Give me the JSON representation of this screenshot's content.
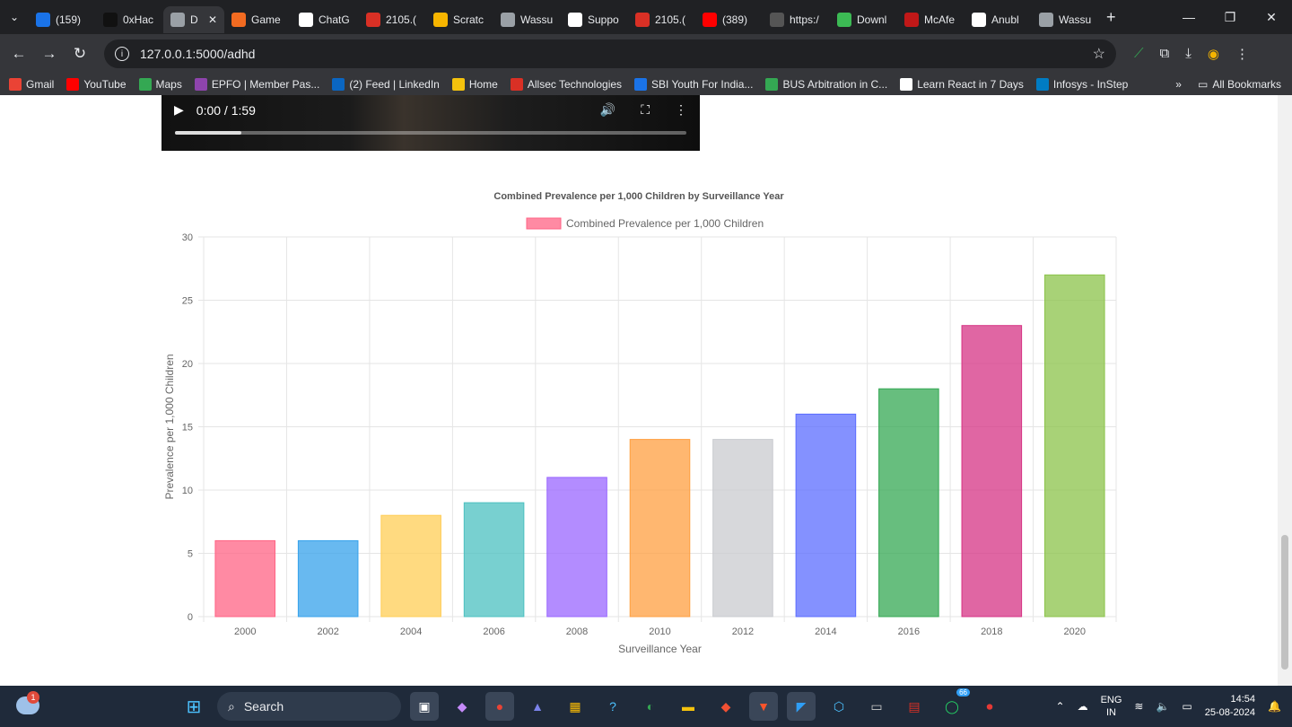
{
  "browser": {
    "tabs": [
      {
        "label": "(159)",
        "color": "#1a73e8"
      },
      {
        "label": "0xHac",
        "color": "#111111"
      },
      {
        "label": "D",
        "color": "#9aa0a6",
        "active": true
      },
      {
        "label": "Game",
        "color": "#f26b21"
      },
      {
        "label": "ChatG",
        "color": "#ffffff"
      },
      {
        "label": "2105.(",
        "color": "#d93025"
      },
      {
        "label": "Scratc",
        "color": "#f7b500"
      },
      {
        "label": "Wassu",
        "color": "#9aa0a6"
      },
      {
        "label": "Suppo",
        "color": "#ffffff"
      },
      {
        "label": "2105.(",
        "color": "#d93025"
      },
      {
        "label": "(389)",
        "color": "#ff0000"
      },
      {
        "label": "https:/",
        "color": "#555555"
      },
      {
        "label": "Downl",
        "color": "#3cba54"
      },
      {
        "label": "McAfe",
        "color": "#c01818"
      },
      {
        "label": "Anubl",
        "color": "#ffffff"
      },
      {
        "label": "Wassu",
        "color": "#9aa0a6"
      }
    ],
    "close_symbol": "✕",
    "new_tab_symbol": "+",
    "url": "127.0.0.1:5000/adhd",
    "bookmarks": [
      {
        "label": "Gmail",
        "color": "#ea4335"
      },
      {
        "label": "YouTube",
        "color": "#ff0000"
      },
      {
        "label": "Maps",
        "color": "#34a853"
      },
      {
        "label": "EPFO | Member Pas...",
        "color": "#8e44ad"
      },
      {
        "label": "(2) Feed | LinkedIn",
        "color": "#0a66c2"
      },
      {
        "label": "Home",
        "color": "#f4c20d"
      },
      {
        "label": "Allsec Technologies",
        "color": "#d93025"
      },
      {
        "label": "SBI Youth For India...",
        "color": "#1a73e8"
      },
      {
        "label": "BUS Arbitration in C...",
        "color": "#34a853"
      },
      {
        "label": "Learn React in 7 Days",
        "color": "#ffffff"
      },
      {
        "label": "Infosys - InStep",
        "color": "#007cc3"
      }
    ],
    "more_bookmarks_symbol": "»",
    "all_bookmarks": "All Bookmarks"
  },
  "video": {
    "time": "0:00 / 1:59",
    "progress": 0.13
  },
  "chart_data": {
    "type": "bar",
    "title": "Combined Prevalence per 1,000 Children by Surveillance Year",
    "xlabel": "Surveillance Year",
    "ylabel": "Prevalence per 1,000 Children",
    "categories": [
      "2000",
      "2002",
      "2004",
      "2006",
      "2008",
      "2010",
      "2012",
      "2014",
      "2016",
      "2018",
      "2020"
    ],
    "series": [
      {
        "name": "Combined Prevalence per 1,000 Children",
        "values": [
          6,
          6,
          8,
          9,
          11,
          14,
          14,
          16,
          18,
          23,
          27
        ]
      }
    ],
    "ylim": [
      0,
      30
    ],
    "yticks": [
      "0",
      "5",
      "10",
      "15",
      "20",
      "25",
      "30"
    ],
    "grid": true,
    "legend": "top",
    "colors": [
      "#ff6384",
      "#36a2eb",
      "#ffcd56",
      "#4bc0c0",
      "#9966ff",
      "#ff9f40",
      "#c9cbcf",
      "#5b6cff",
      "#34a853",
      "#d63384",
      "#8bc34a"
    ]
  },
  "taskbar": {
    "search": "Search",
    "weather_badge": "1",
    "whatsapp_badge": "66",
    "lang": [
      "ENG",
      "IN"
    ],
    "time": "14:54",
    "date": "25-08-2024"
  }
}
